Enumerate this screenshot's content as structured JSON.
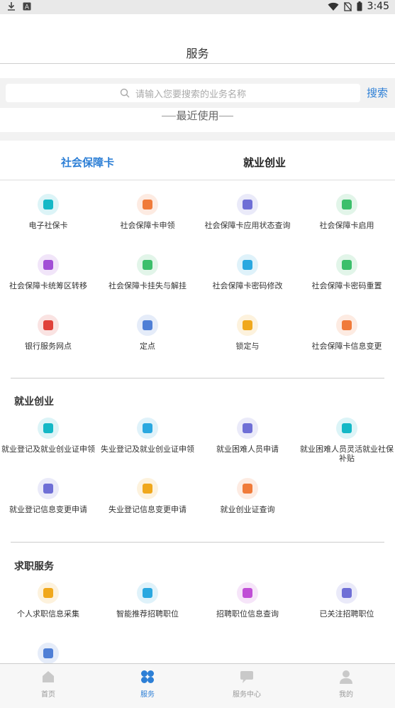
{
  "status": {
    "time": "3:45"
  },
  "header": {
    "title": "服务"
  },
  "search": {
    "placeholder": "请输入您要搜索的业务名称",
    "button": "搜索"
  },
  "recent": {
    "label": "最近使用"
  },
  "tabs": [
    {
      "label": "社会保障卡"
    },
    {
      "label": "就业创业"
    }
  ],
  "social_items": [
    {
      "label": "电子社保卡",
      "icon": "id-card-icon",
      "color": "#14b8c6"
    },
    {
      "label": "社会保障卡申领",
      "icon": "card-apply-icon",
      "color": "#f07b3a"
    },
    {
      "label": "社会保障卡应用状态查询",
      "icon": "card-search-icon",
      "color": "#6f6fd6"
    },
    {
      "label": "社会保障卡启用",
      "icon": "card-enable-icon",
      "color": "#3cbf6b"
    },
    {
      "label": "社会保障卡统筹区转移",
      "icon": "transfer-icon",
      "color": "#a24fd6"
    },
    {
      "label": "社会保障卡挂失与解挂",
      "icon": "card-lost-icon",
      "color": "#3cbf6b"
    },
    {
      "label": "社会保障卡密码修改",
      "icon": "password-edit-icon",
      "color": "#2aa8e0"
    },
    {
      "label": "社会保障卡密码重置",
      "icon": "password-reset-icon",
      "color": "#3cbf6b"
    },
    {
      "label": "银行服务网点",
      "icon": "bank-icon",
      "color": "#e0413a"
    },
    {
      "label": "定点",
      "icon": "location-card-icon",
      "color": "#4f7fd6"
    },
    {
      "label": "锁定与",
      "icon": "lock-card-icon",
      "color": "#f0a81c"
    },
    {
      "label": "社会保障卡信息变更",
      "icon": "card-change-icon",
      "color": "#f07b3a"
    }
  ],
  "employment": {
    "title": "就业创业",
    "items": [
      {
        "label": "就业登记及就业创业证申领",
        "icon": "employment-register-icon",
        "color": "#14b8c6"
      },
      {
        "label": "失业登记及就业创业证申领",
        "icon": "unemployment-register-icon",
        "color": "#2aa8e0"
      },
      {
        "label": "就业困难人员申请",
        "icon": "briefcase-apply-icon",
        "color": "#6f6fd6"
      },
      {
        "label": "就业困难人员灵活就业社保补贴",
        "icon": "subsidy-bag-icon",
        "color": "#14b8c6"
      },
      {
        "label": "就业登记信息变更申请",
        "icon": "employment-change-icon",
        "color": "#6f6fd6"
      },
      {
        "label": "失业登记信息变更申请",
        "icon": "unemployment-change-icon",
        "color": "#f0a81c"
      },
      {
        "label": "就业创业证查询",
        "icon": "certificate-query-icon",
        "color": "#f07b3a"
      }
    ]
  },
  "job": {
    "title": "求职服务",
    "items": [
      {
        "label": "个人求职信息采集",
        "icon": "resume-icon",
        "color": "#f0a81c"
      },
      {
        "label": "智能推荐招聘职位",
        "icon": "briefcase-icon",
        "color": "#2aa8e0"
      },
      {
        "label": "招聘职位信息查询",
        "icon": "tie-icon",
        "color": "#c04fd6"
      },
      {
        "label": "已关注招聘职位",
        "icon": "followed-job-icon",
        "color": "#6f6fd6"
      },
      {
        "label": "",
        "icon": "job-more-icon",
        "color": "#4f7fd6"
      }
    ]
  },
  "bottom_nav": [
    {
      "label": "首页",
      "icon": "home-icon"
    },
    {
      "label": "服务",
      "icon": "services-icon"
    },
    {
      "label": "服务中心",
      "icon": "service-center-icon"
    },
    {
      "label": "我的",
      "icon": "profile-icon"
    }
  ]
}
